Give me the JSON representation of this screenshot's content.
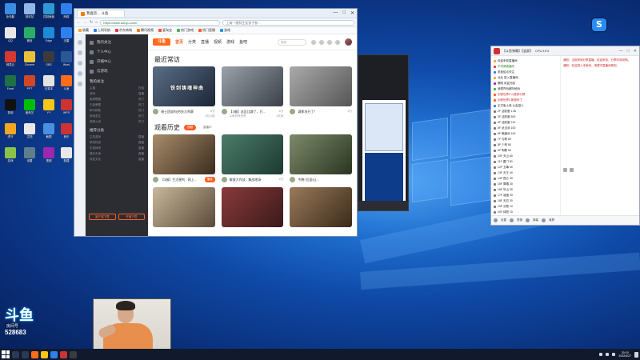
{
  "browser": {
    "tab_title": "我喜欢... 斗鱼",
    "url": "https://www.douyu.com/",
    "search_text": "上海一理科生女孩子参...",
    "window_controls": [
      "—",
      "□",
      "✕"
    ],
    "nav": [
      "←",
      "→",
      "↻",
      "⌂"
    ],
    "bookmarks": [
      {
        "label": "收藏",
        "color": "#f5a623"
      },
      {
        "label": "上网导航",
        "color": "#2f80ed"
      },
      {
        "label": "京东商城",
        "color": "#e53935"
      },
      {
        "label": "腾讯视频",
        "color": "#ff7a00"
      },
      {
        "label": "爱淘宝",
        "color": "#ff4b2b"
      },
      {
        "label": "热门游戏",
        "color": "#4caf50"
      },
      {
        "label": "热门直播",
        "color": "#ff5d23"
      },
      {
        "label": "游戏",
        "color": "#2196f3"
      }
    ]
  },
  "douyu": {
    "logo_text": "斗鱼",
    "nav": [
      "首页",
      "分类",
      "直播",
      "视频",
      "游戏",
      "鱼吧"
    ],
    "search_placeholder": "搜索",
    "sidebar": {
      "items": [
        "我的关注",
        "个人中心",
        "开播中心",
        "云游戏"
      ],
      "section1": "我的关注",
      "section1_rows": [
        [
          "主播",
          "在线"
        ],
        [
          "游戏",
          "直播"
        ],
        [
          "英雄联盟",
          "热门"
        ],
        [
          "王者荣耀",
          "热门"
        ],
        [
          "和平精英",
          "热门"
        ],
        [
          "绝地求生",
          "热门"
        ],
        [
          "穿越火线",
          "热门"
        ]
      ],
      "section2": "推荐分类",
      "section2_rows": [
        [
          "主机游戏",
          "直播"
        ],
        [
          "单机热游",
          "直播"
        ],
        [
          "手游休闲",
          "直播"
        ],
        [
          "娱乐天地",
          "直播"
        ],
        [
          "科技文化",
          "直播"
        ]
      ],
      "btn_left": "客户端下载",
      "btn_right": "开播下载"
    },
    "recent_title": "最近常访",
    "history_title": "观看历史",
    "history_pills": [
      "视频",
      "直播中"
    ],
    "recent_cards": [
      {
        "title": "骑士团说吗|穷技大师赛",
        "count": "6万",
        "sub_left": "",
        "sub_right": "2天以前",
        "watermark": "铁剑铸魂神曲",
        "colors": [
          "#5a6e86",
          "#1c2636"
        ]
      },
      {
        "title": "【3服】这区比赛了，打...",
        "count": "6万",
        "sub_left": "斗鱼剑侠世界",
        "sub_right": "4天前",
        "watermark": "",
        "colors": [
          "#9aa2aa",
          "#3b4048"
        ]
      },
      {
        "title": "满那块开了！",
        "count": "6万",
        "sub_left": "",
        "sub_right": "",
        "watermark": "",
        "colors": [
          "#aaaaaa",
          "#555555"
        ]
      }
    ],
    "history_cards": [
      {
        "title": "【3服】生活便利 - 网上...",
        "count": "",
        "play": "播放",
        "colors": [
          "#a98c6a",
          "#3a2c1f"
        ]
      },
      {
        "title": "解放大作战 - 集战地场",
        "count": "6万",
        "play": "",
        "colors": [
          "#4b7c6a",
          "#1d3a30"
        ]
      },
      {
        "title": "今晚?后面!让...",
        "count": "",
        "play": "",
        "colors": [
          "#7c8a6a",
          "#2a3520"
        ]
      }
    ]
  },
  "chat": {
    "title": "【斗鱼弹幕】【竖屏】",
    "stats": "CPU:11%",
    "controls": [
      "—",
      "□",
      "✕"
    ],
    "lines": [
      {
        "text": "欢迎来到直播间",
        "color": "#222",
        "flag": "#f5a623"
      },
      {
        "text": "不洗牌直播间",
        "color": "#2a8f2a",
        "flag": "#e53935"
      },
      {
        "text": "老板给点关注",
        "color": "#222",
        "flag": "#2f80ed"
      },
      {
        "text": "北北 进入直播间",
        "color": "#222",
        "flag": "#f5a623"
      },
      {
        "text": "鹿晗 欢迎光临",
        "color": "#222",
        "flag": "#9c27b0"
      },
      {
        "text": "我想咋玩都叫他玩",
        "color": "#222",
        "flag": "#4caf50"
      },
      {
        "text": "剑侠世界3 斗鱼排行榜",
        "color": "#c22",
        "flag": "#ff5d23"
      },
      {
        "text": "剑侠世界3 新服来了",
        "color": "#c22",
        "flag": "#ff5d23"
      },
      {
        "text": "正式版上线 公会招人",
        "color": "#222",
        "flag": "#2f80ed"
      },
      {
        "text": "2F 活跃度 1.0k",
        "color": "#222",
        "flag": "#777"
      },
      {
        "text": "3F 活跃度 500",
        "color": "#222",
        "flag": "#777"
      },
      {
        "text": "4F 活跃度 210",
        "color": "#222",
        "flag": "#777"
      },
      {
        "text": "5F 武当派 100",
        "color": "#222",
        "flag": "#777"
      },
      {
        "text": "6F 峨眉派 100",
        "color": "#222",
        "flag": "#777"
      },
      {
        "text": "7F 丐帮 80",
        "color": "#222",
        "flag": "#777"
      },
      {
        "text": "8F 少林 80",
        "color": "#222",
        "flag": "#777"
      },
      {
        "text": "9F 明教 60",
        "color": "#222",
        "flag": "#777"
      },
      {
        "text": "10F 天山 60",
        "color": "#222",
        "flag": "#777"
      },
      {
        "text": "11F 唐门 50",
        "color": "#222",
        "flag": "#777"
      },
      {
        "text": "12F 五毒 50",
        "color": "#222",
        "flag": "#777"
      },
      {
        "text": "13F 天王 40",
        "color": "#222",
        "flag": "#777"
      },
      {
        "text": "14F 昆仑 40",
        "color": "#222",
        "flag": "#777"
      },
      {
        "text": "15F 翠烟 30",
        "color": "#222",
        "flag": "#777"
      },
      {
        "text": "16F 华山 30",
        "color": "#222",
        "flag": "#777"
      },
      {
        "text": "17F 逍遥 20",
        "color": "#222",
        "flag": "#777"
      },
      {
        "text": "18F 天忍 20",
        "color": "#222",
        "flag": "#777"
      },
      {
        "text": "19F 长歌 10",
        "color": "#222",
        "flag": "#777"
      },
      {
        "text": "20F 纯阳 10",
        "color": "#222",
        "flag": "#777"
      },
      {
        "text": "21F 藏剑 10",
        "color": "#222",
        "flag": "#777"
      }
    ],
    "notices": [
      "通知：当前房间分享直播，欢迎来到，分享时请说明。",
      "通知：欢迎进入本房间，请遵守直播间规则。"
    ],
    "bottom": [
      "设置",
      "表情",
      "弹幕",
      "清屏"
    ]
  },
  "overlay": {
    "brand": "斗鱼",
    "room_label": "房间号",
    "room_number": "528683",
    "s_badge": "S"
  },
  "taskbar": {
    "time": "20:19",
    "date": "2022/4/27"
  },
  "desktop_icons": [
    {
      "label": "此电脑",
      "color": "#3a8de0"
    },
    {
      "label": "回收站",
      "color": "#8fb8e8"
    },
    {
      "label": "控制面板",
      "color": "#2d9ad6"
    },
    {
      "label": "网络",
      "color": "#2f80ed"
    },
    {
      "label": "QQ",
      "color": "#e8e8e8"
    },
    {
      "label": "微信",
      "color": "#2aae67"
    },
    {
      "label": "Edge",
      "color": "#1f8ad6"
    },
    {
      "label": "迅雷",
      "color": "#2f80ed"
    },
    {
      "label": "网易云",
      "color": "#d33a31"
    },
    {
      "label": "Chrome",
      "color": "#e8c23b"
    },
    {
      "label": "OBS",
      "color": "#3b3b3b"
    },
    {
      "label": "Word",
      "color": "#2b5797"
    },
    {
      "label": "Excel",
      "color": "#1e7145"
    },
    {
      "label": "PPT",
      "color": "#d24726"
    },
    {
      "label": "记事本",
      "color": "#e3e3e3"
    },
    {
      "label": "斗鱼",
      "color": "#ff6d1b"
    },
    {
      "label": "剪映",
      "color": "#111111"
    },
    {
      "label": "爱奇艺",
      "color": "#00be06"
    },
    {
      "label": "YY",
      "color": "#f5c518"
    },
    {
      "label": "WPS",
      "color": "#c33"
    },
    {
      "label": "虎牙",
      "color": "#f5a623"
    },
    {
      "label": "文档",
      "color": "#e8e8e8"
    },
    {
      "label": "截图",
      "color": "#4a90e2"
    },
    {
      "label": "音乐",
      "color": "#c33"
    },
    {
      "label": "游戏",
      "color": "#8bc34a"
    },
    {
      "label": "设置",
      "color": "#607d8b"
    },
    {
      "label": "视频",
      "color": "#9c27b0"
    },
    {
      "label": "新建",
      "color": "#e8e8e8"
    }
  ]
}
